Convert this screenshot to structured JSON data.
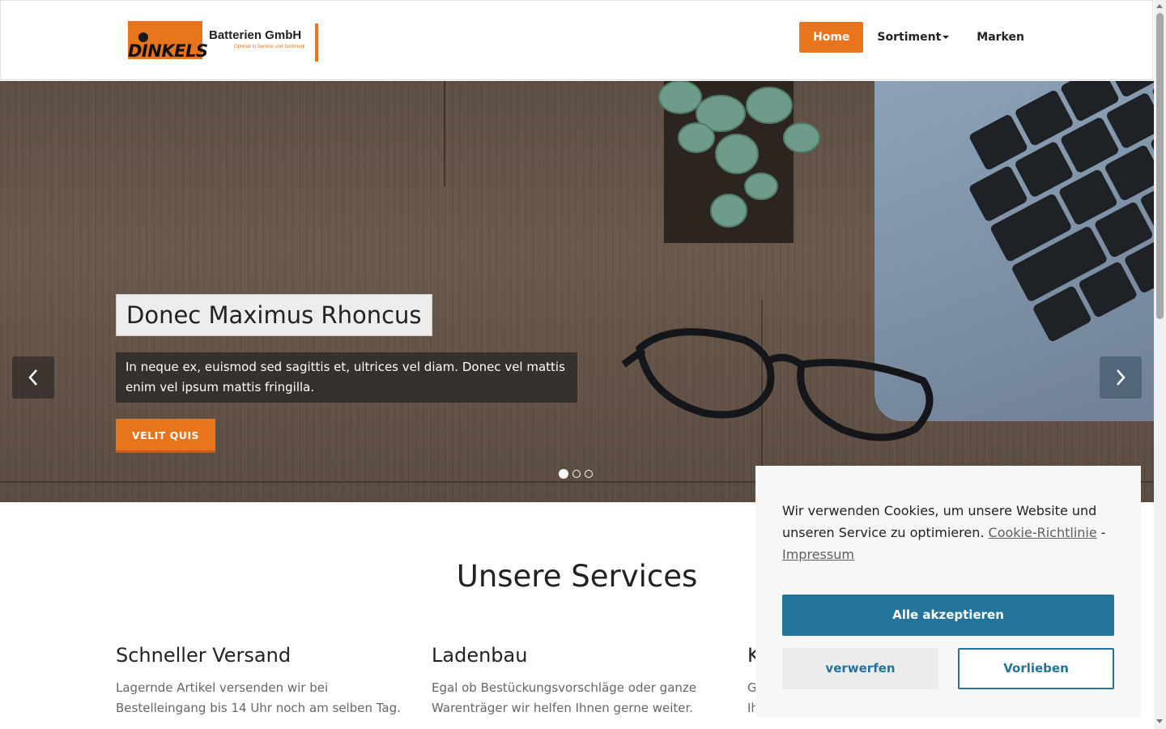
{
  "brand": {
    "wordmark": "DINKELS",
    "name": "Batterien GmbH",
    "tagline": "Optimal in Service und Sortiment",
    "accent_color": "#e8741e"
  },
  "nav": {
    "items": [
      {
        "label": "Home",
        "active": true
      },
      {
        "label": "Sortiment",
        "has_dropdown": true
      },
      {
        "label": "Marken"
      }
    ]
  },
  "hero": {
    "title": "Donec Maximus Rhoncus",
    "text": "In neque ex, euismod sed sagittis et, ultrices vel diam. Donec vel mattis enim vel ipsum mattis fringilla.",
    "cta_label": "VELIT QUIS",
    "slide_count": 3,
    "active_slide": 1,
    "prev_icon": "chevron-left-icon",
    "next_icon": "chevron-right-icon"
  },
  "services": {
    "title": "Unsere Services",
    "items": [
      {
        "title": "Schneller Versand",
        "text": "Lagernde Artikel versenden wir bei Bestelleingang bis 14 Uhr noch am selben Tag."
      },
      {
        "title": "Ladenbau",
        "text": "Egal ob Bestückungsvorschläge oder ganze Warenträger wir helfen Ihnen gerne weiter."
      },
      {
        "title": "K",
        "text": "G Ih"
      }
    ]
  },
  "cookie": {
    "message": "Wir verwenden Cookies, um unsere Website und unseren Service zu optimieren.",
    "policy_link": "Cookie-Richtlinie",
    "separator": "-",
    "imprint_link": "Impressum",
    "accept_label": "Alle akzeptieren",
    "deny_label": "verwerfen",
    "prefs_label": "Vorlieben",
    "button_color": "#23739a"
  }
}
